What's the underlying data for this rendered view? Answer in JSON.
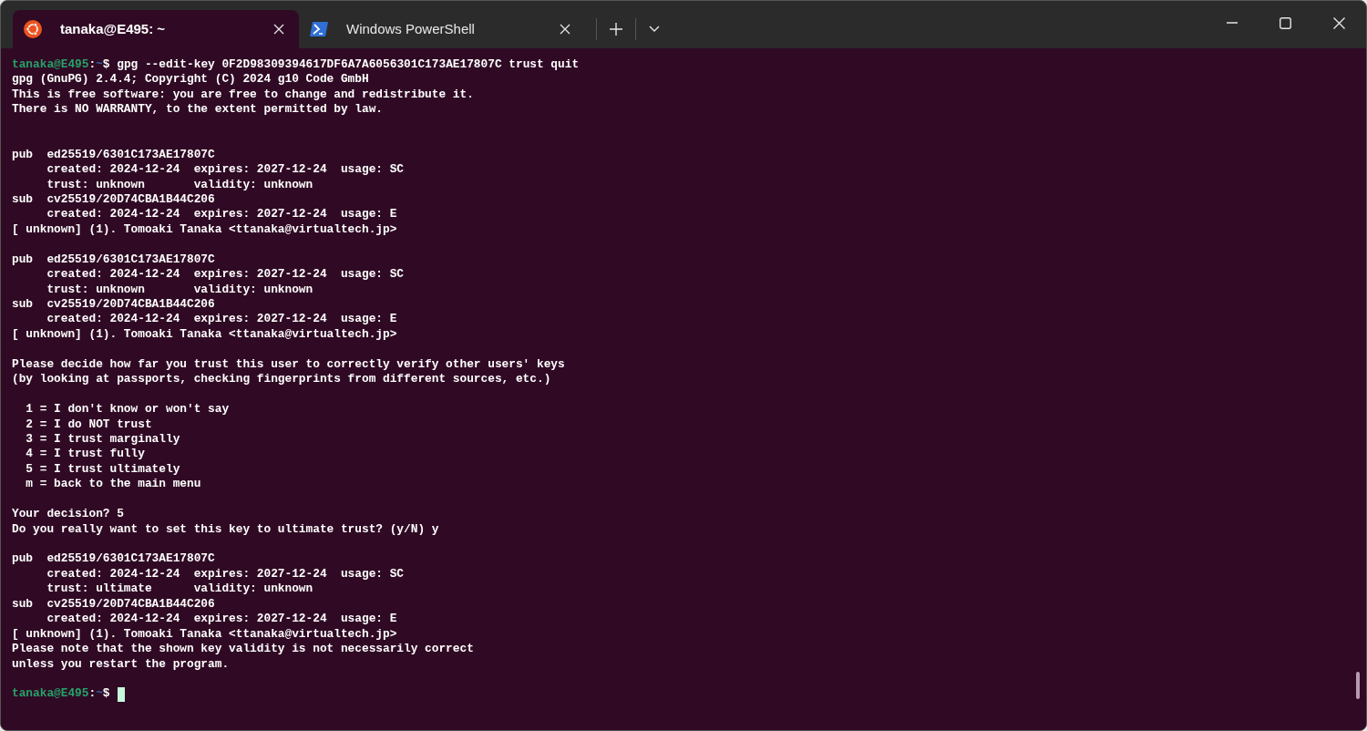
{
  "tabs": [
    {
      "kind": "ubuntu",
      "title": "tanaka@E495: ~",
      "selected": true
    },
    {
      "kind": "powershell",
      "title": "Windows PowerShell",
      "selected": false
    }
  ],
  "terminal": {
    "lines": [
      {
        "kind": "prompt",
        "user": "tanaka@E495",
        "sep": ":",
        "path": "~",
        "symbol": "$",
        "command": " gpg --edit-key 0F2D98309394617DF6A7A6056301C173AE17807C trust quit"
      },
      {
        "kind": "output",
        "text": "gpg (GnuPG) 2.4.4; Copyright (C) 2024 g10 Code GmbH"
      },
      {
        "kind": "output",
        "text": "This is free software: you are free to change and redistribute it."
      },
      {
        "kind": "output",
        "text": "There is NO WARRANTY, to the extent permitted by law."
      },
      {
        "kind": "blank"
      },
      {
        "kind": "blank"
      },
      {
        "kind": "output",
        "text": "pub  ed25519/6301C173AE17807C"
      },
      {
        "kind": "output",
        "text": "     created: 2024-12-24  expires: 2027-12-24  usage: SC"
      },
      {
        "kind": "output",
        "text": "     trust: unknown       validity: unknown"
      },
      {
        "kind": "output",
        "text": "sub  cv25519/20D74CBA1B44C206"
      },
      {
        "kind": "output",
        "text": "     created: 2024-12-24  expires: 2027-12-24  usage: E"
      },
      {
        "kind": "output",
        "text": "[ unknown] (1). Tomoaki Tanaka <ttanaka@virtualtech.jp>"
      },
      {
        "kind": "blank"
      },
      {
        "kind": "output",
        "text": "pub  ed25519/6301C173AE17807C"
      },
      {
        "kind": "output",
        "text": "     created: 2024-12-24  expires: 2027-12-24  usage: SC"
      },
      {
        "kind": "output",
        "text": "     trust: unknown       validity: unknown"
      },
      {
        "kind": "output",
        "text": "sub  cv25519/20D74CBA1B44C206"
      },
      {
        "kind": "output",
        "text": "     created: 2024-12-24  expires: 2027-12-24  usage: E"
      },
      {
        "kind": "output",
        "text": "[ unknown] (1). Tomoaki Tanaka <ttanaka@virtualtech.jp>"
      },
      {
        "kind": "blank"
      },
      {
        "kind": "output",
        "text": "Please decide how far you trust this user to correctly verify other users' keys"
      },
      {
        "kind": "output",
        "text": "(by looking at passports, checking fingerprints from different sources, etc.)"
      },
      {
        "kind": "blank"
      },
      {
        "kind": "output",
        "text": "  1 = I don't know or won't say"
      },
      {
        "kind": "output",
        "text": "  2 = I do NOT trust"
      },
      {
        "kind": "output",
        "text": "  3 = I trust marginally"
      },
      {
        "kind": "output",
        "text": "  4 = I trust fully"
      },
      {
        "kind": "output",
        "text": "  5 = I trust ultimately"
      },
      {
        "kind": "output",
        "text": "  m = back to the main menu"
      },
      {
        "kind": "blank"
      },
      {
        "kind": "output",
        "text": "Your decision? 5"
      },
      {
        "kind": "output",
        "text": "Do you really want to set this key to ultimate trust? (y/N) y"
      },
      {
        "kind": "blank"
      },
      {
        "kind": "output",
        "text": "pub  ed25519/6301C173AE17807C"
      },
      {
        "kind": "output",
        "text": "     created: 2024-12-24  expires: 2027-12-24  usage: SC"
      },
      {
        "kind": "output",
        "text": "     trust: ultimate      validity: unknown"
      },
      {
        "kind": "output",
        "text": "sub  cv25519/20D74CBA1B44C206"
      },
      {
        "kind": "output",
        "text": "     created: 2024-12-24  expires: 2027-12-24  usage: E"
      },
      {
        "kind": "output",
        "text": "[ unknown] (1). Tomoaki Tanaka <ttanaka@virtualtech.jp>"
      },
      {
        "kind": "output",
        "text": "Please note that the shown key validity is not necessarily correct"
      },
      {
        "kind": "output",
        "text": "unless you restart the program."
      },
      {
        "kind": "blank"
      },
      {
        "kind": "prompt",
        "user": "tanaka@E495",
        "sep": ":",
        "path": "~",
        "symbol": "$",
        "cursor": true
      }
    ]
  }
}
